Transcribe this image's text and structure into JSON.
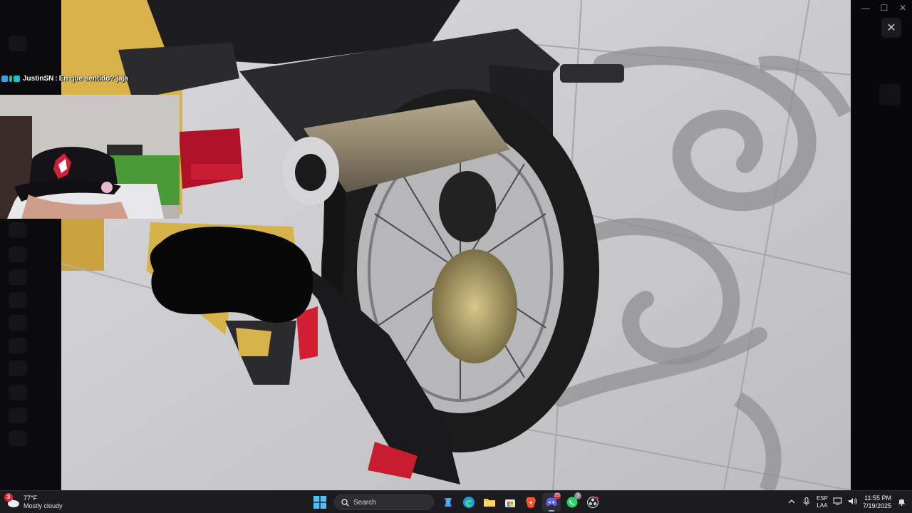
{
  "chat": {
    "username": "JustinSN",
    "separator": ":",
    "message": "En que sentido? jaja"
  },
  "viewer": {
    "close_glyph": "✕",
    "minimize_glyph": "—",
    "maximize_glyph": "☐",
    "window_close_glyph": "✕"
  },
  "taskbar": {
    "weather": {
      "badge": "3",
      "temperature": "77°F",
      "condition": "Mostly cloudy"
    },
    "search_label": "Search",
    "discord_badge": "25",
    "whatsapp_badge": "3",
    "tray": {
      "lang_line1": "ESP",
      "lang_line2": "LAA",
      "time": "11:55 PM",
      "date": "7/19/2025"
    }
  },
  "colors": {
    "taskbar": "#1c1c1f",
    "accent": "#9aa6ff",
    "badge_red": "#d8293b"
  },
  "icons": [
    "weather-cloud-icon",
    "windows-start-icon",
    "search-icon",
    "copilot-icon",
    "edge-icon",
    "file-explorer-icon",
    "store-icon",
    "brave-icon",
    "discord-icon",
    "whatsapp-icon",
    "obs-icon",
    "chevron-up-icon",
    "microphone-icon",
    "network-icon",
    "volume-icon",
    "notification-icon"
  ]
}
